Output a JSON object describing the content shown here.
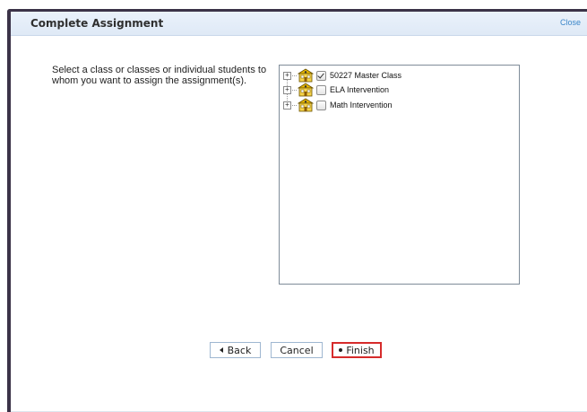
{
  "dialog": {
    "title": "Complete Assignment",
    "close_label": "Close"
  },
  "instruction": "Select a class or classes or individual students to whom you want to assign the assignment(s).",
  "tree": {
    "items": [
      {
        "label": "50227 Master Class",
        "checked": true,
        "icon": "class-building-icon"
      },
      {
        "label": "ELA Intervention",
        "checked": false,
        "icon": "class-building-icon"
      },
      {
        "label": "Math Intervention",
        "checked": false,
        "icon": "class-building-icon"
      }
    ]
  },
  "buttons": {
    "back_label": "Back",
    "cancel_label": "Cancel",
    "finish_label": "Finish"
  },
  "colors": {
    "frame": "#3b3348",
    "link": "#3b86c9",
    "highlight": "#d62b2b",
    "header_bg": "#eaf2fb"
  }
}
